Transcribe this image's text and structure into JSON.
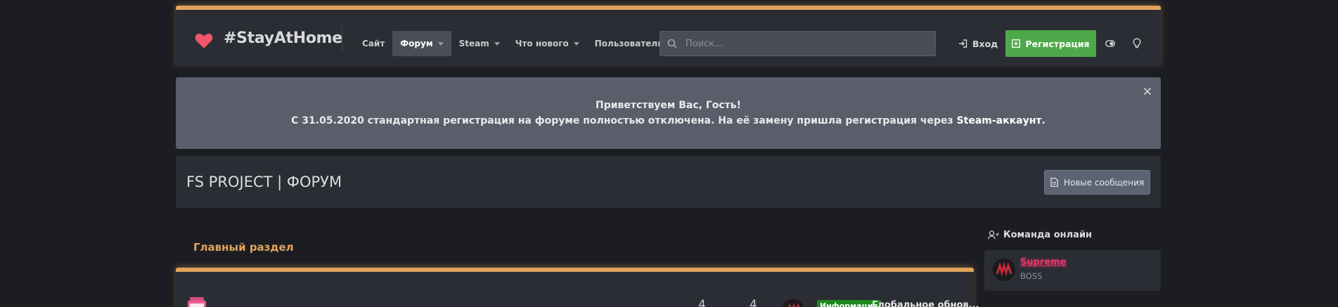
{
  "header": {
    "logo_text": "#StayAtHome",
    "nav": [
      {
        "label": "Сайт",
        "has_caret": false,
        "active": false
      },
      {
        "label": "Форум",
        "has_caret": true,
        "active": true
      },
      {
        "label": "Steam",
        "has_caret": true,
        "active": false
      },
      {
        "label": "Что нового",
        "has_caret": true,
        "active": false
      },
      {
        "label": "Пользователи",
        "has_caret": true,
        "active": false
      }
    ],
    "search_placeholder": "Поиск...",
    "login_label": "Вход",
    "register_label": "Регистрация",
    "accent_color": "#e1a35c",
    "register_color": "#4fa94b"
  },
  "notice": {
    "line1": "Приветствуем Вас, Гость!",
    "line2_prefix": "С 31.05.2020 стандартная регистрация на форуме полностью отключена. На её замену пришла регистрация через ",
    "line2_strong": "Steam-аккаунт",
    "line2_suffix": "."
  },
  "page": {
    "title": "FS PROJECT | ФОРУМ",
    "new_posts_label": "Новые сообщения"
  },
  "section": {
    "title": "Главный раздел",
    "node": {
      "threads": "4",
      "messages": "4",
      "prefix": "Информация",
      "last_thread": "Глобальное обнов..."
    }
  },
  "sidebar": {
    "title": "Команда онлайн",
    "member": {
      "name": "Supreme",
      "role": "BOSS",
      "name_color": "#e8356a"
    }
  },
  "icons": [
    "heart-icon",
    "search-icon",
    "login-icon",
    "register-plus-icon",
    "style-toggle-icon",
    "bulb-icon",
    "close-icon",
    "document-icon",
    "users-icon"
  ]
}
